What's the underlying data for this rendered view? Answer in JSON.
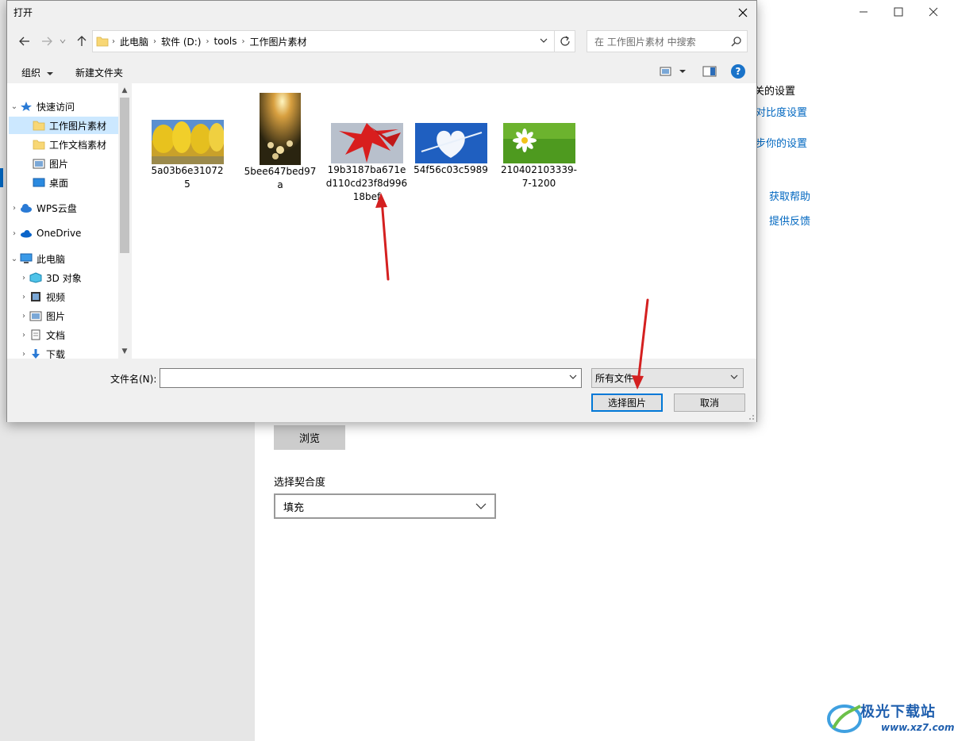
{
  "background_window": {
    "related_settings_partial": "关的设置",
    "links": [
      "对比度设置",
      "步你的设置",
      "获取帮助",
      "提供反馈"
    ],
    "browse_label": "浏览",
    "fit_label": "选择契合度",
    "fit_value": "填充"
  },
  "dialog": {
    "title": "打开",
    "breadcrumb": [
      "此电脑",
      "软件 (D:)",
      "tools",
      "工作图片素材"
    ],
    "search_placeholder": "在 工作图片素材 中搜索",
    "toolbar": {
      "organize": "组织",
      "new_folder": "新建文件夹"
    },
    "nav": {
      "quick_access": "快速访问",
      "work_images": "工作图片素材",
      "work_docs": "工作文档素材",
      "pictures": "图片",
      "desktop": "桌面",
      "wps_cloud": "WPS云盘",
      "onedrive": "OneDrive",
      "this_pc": "此电脑",
      "objects_3d": "3D 对象",
      "videos": "视频",
      "pictures2": "图片",
      "documents": "文档",
      "downloads": "下载"
    },
    "files": [
      {
        "name": "5a03b6e310725",
        "thumb": "yellow-trees"
      },
      {
        "name": "5bee647bed97a",
        "thumb": "sunset-flowers"
      },
      {
        "name": "19b3187ba671ed110cd23f8d99618bef",
        "thumb": "red-leaves"
      },
      {
        "name": "54f56c03c5989",
        "thumb": "heart-cloud"
      },
      {
        "name": "210402103339-7-1200",
        "thumb": "daisy"
      }
    ],
    "filename_label": "文件名(N):",
    "filename_value": "",
    "filetype_value": "所有文件",
    "ok_label": "选择图片",
    "cancel_label": "取消"
  },
  "watermark": {
    "name": "极光下载站",
    "url": "www.xz7.com"
  },
  "colors": {
    "accent": "#0067c0",
    "selection": "#cce8ff",
    "annotation_arrow": "#d42020"
  }
}
